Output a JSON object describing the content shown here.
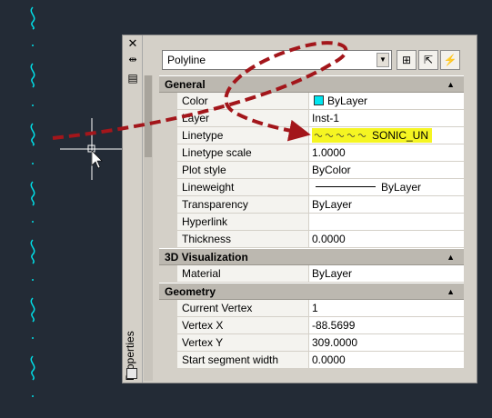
{
  "panel": {
    "vertical_label": "Properties",
    "close_icon": "close-icon",
    "autohide_icon": "autohide-icon",
    "menu_icon": "properties-menu-icon"
  },
  "selector": {
    "value": "Polyline"
  },
  "toolbar": {
    "pickadd_icon": "toggle-pickadd-icon",
    "select_icon": "select-objects-icon",
    "quickselect_icon": "quick-select-icon"
  },
  "general": {
    "title": "General",
    "rows": [
      {
        "name": "Color",
        "value": "ByLayer"
      },
      {
        "name": "Layer",
        "value": "Inst-1"
      },
      {
        "name": "Linetype",
        "value": "SONIC_UN"
      },
      {
        "name": "Linetype scale",
        "value": "1.0000"
      },
      {
        "name": "Plot style",
        "value": "ByColor"
      },
      {
        "name": "Lineweight",
        "value": "ByLayer"
      },
      {
        "name": "Transparency",
        "value": "ByLayer"
      },
      {
        "name": "Hyperlink",
        "value": ""
      },
      {
        "name": "Thickness",
        "value": "0.0000"
      }
    ]
  },
  "viz": {
    "title": "3D Visualization",
    "rows": [
      {
        "name": "Material",
        "value": "ByLayer"
      }
    ]
  },
  "geometry": {
    "title": "Geometry",
    "rows": [
      {
        "name": "Current Vertex",
        "value": "1"
      },
      {
        "name": "Vertex X",
        "value": "-88.5699"
      },
      {
        "name": "Vertex Y",
        "value": "309.0000"
      },
      {
        "name": "Start segment width",
        "value": "0.0000"
      }
    ]
  },
  "colors": {
    "accent_cyan": "#00e5ef",
    "highlight": "#f5f522",
    "arrow_red": "#a3161b",
    "canvas": "#232b36"
  }
}
